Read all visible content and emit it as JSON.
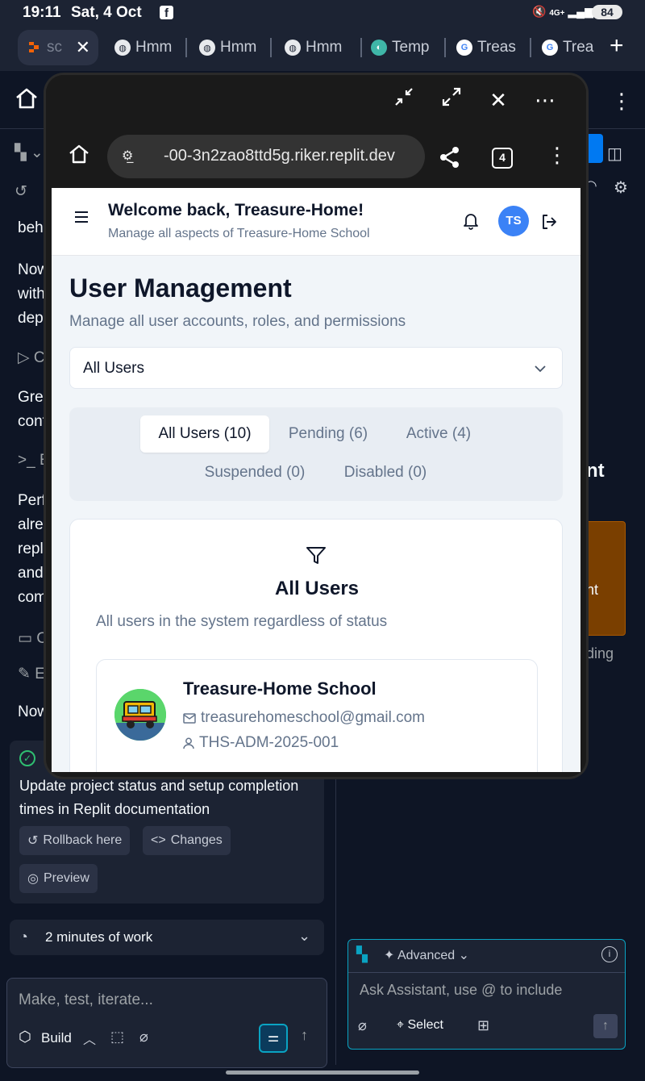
{
  "status_bar": {
    "time": "19:11",
    "date": "Sat, 4 Oct",
    "network": "4G+",
    "battery": "84"
  },
  "browser_tabs": [
    {
      "label": "sc",
      "icon": "replit-icon",
      "active": true
    },
    {
      "label": "Hmm",
      "icon": "globe-icon"
    },
    {
      "label": "Hmm",
      "icon": "globe-icon"
    },
    {
      "label": "Hmm",
      "icon": "globe-icon"
    },
    {
      "label": "Temp",
      "icon": "temp-icon"
    },
    {
      "label": "Treas",
      "icon": "google-icon"
    },
    {
      "label": "Trea",
      "icon": "google-icon"
    }
  ],
  "background_app": {
    "left_fragments": [
      "beha",
      "Now",
      "with",
      "depl",
      "C",
      "Grea",
      "conf",
      "E",
      "Perf",
      "alrea",
      "repl",
      "and",
      "com",
      "C",
      "E",
      "Now"
    ],
    "checkpoint_text": "Update project status and setup completion times in Replit documentation",
    "rollback_label": "Rollback here",
    "changes_label": "Changes",
    "preview_label": "Preview",
    "work_label": "2 minutes of work",
    "input_placeholder": "Make, test, iterate...",
    "build_label": "Build",
    "right_fragments": {
      "nt": "nt",
      "ent": "ent",
      "ding": "ding"
    },
    "assistant": {
      "mode_label": "Advanced",
      "placeholder": "Ask Assistant, use @ to include",
      "select_label": "Select"
    }
  },
  "modal_browser": {
    "url": "-00-3n2zao8ttd5g.riker.replit.dev",
    "tab_count": "4"
  },
  "page": {
    "header": {
      "welcome": "Welcome back, Treasure-Home!",
      "subtitle": "Manage all aspects of Treasure-Home School",
      "avatar_initials": "TS"
    },
    "title": "User Management",
    "subtitle": "Manage all user accounts, roles, and permissions",
    "filter_select": {
      "value": "All Users"
    },
    "tabs": [
      {
        "label": "All Users (10)",
        "active": true
      },
      {
        "label": "Pending (6)"
      },
      {
        "label": "Active (4)"
      },
      {
        "label": "Suspended (0)"
      },
      {
        "label": "Disabled (0)"
      }
    ],
    "card": {
      "title": "All Users",
      "description": "All users in the system regardless of status"
    },
    "user": {
      "name": "Treasure-Home School",
      "email": "treasurehomeschool@gmail.com",
      "id": "THS-ADM-2025-001"
    }
  },
  "colors": {
    "accent_blue": "#3b82f6",
    "replit_orange": "#f26207",
    "assistant_border": "#0aa3c2"
  }
}
